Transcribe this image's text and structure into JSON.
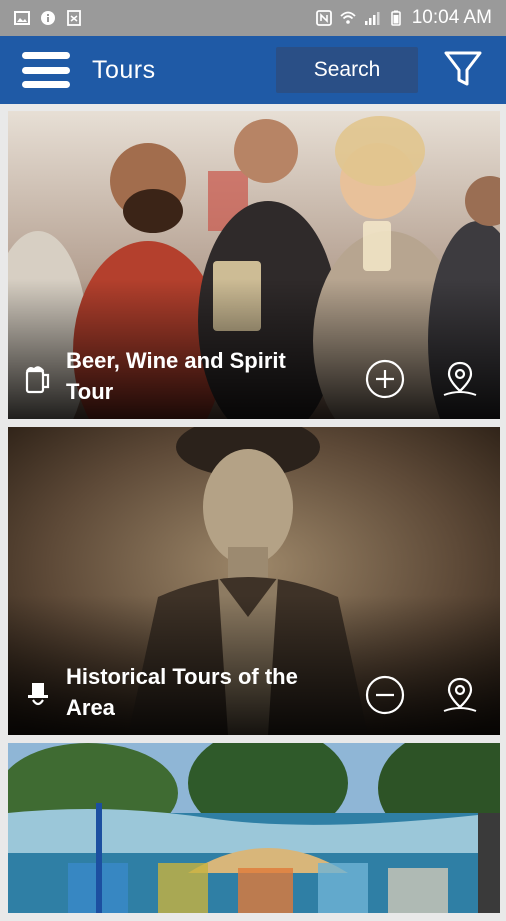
{
  "status_bar": {
    "time": "10:04 AM"
  },
  "app_bar": {
    "title": "Tours",
    "search_label": "Search"
  },
  "tours": [
    {
      "title": "Beer, Wine and Spirit Tour",
      "category_icon": "beer-mug-icon",
      "action_icon": "plus-circle-icon",
      "location_icon": "map-pin-icon"
    },
    {
      "title": "Historical Tours of the Area",
      "category_icon": "top-hat-icon",
      "action_icon": "minus-circle-icon",
      "location_icon": "map-pin-icon"
    },
    {
      "title": "",
      "category_icon": "",
      "action_icon": "",
      "location_icon": ""
    }
  ],
  "colors": {
    "app_bar": "#1f5aa6",
    "search_button": "#2a4f86",
    "status_bar": "#9a9a9a"
  }
}
